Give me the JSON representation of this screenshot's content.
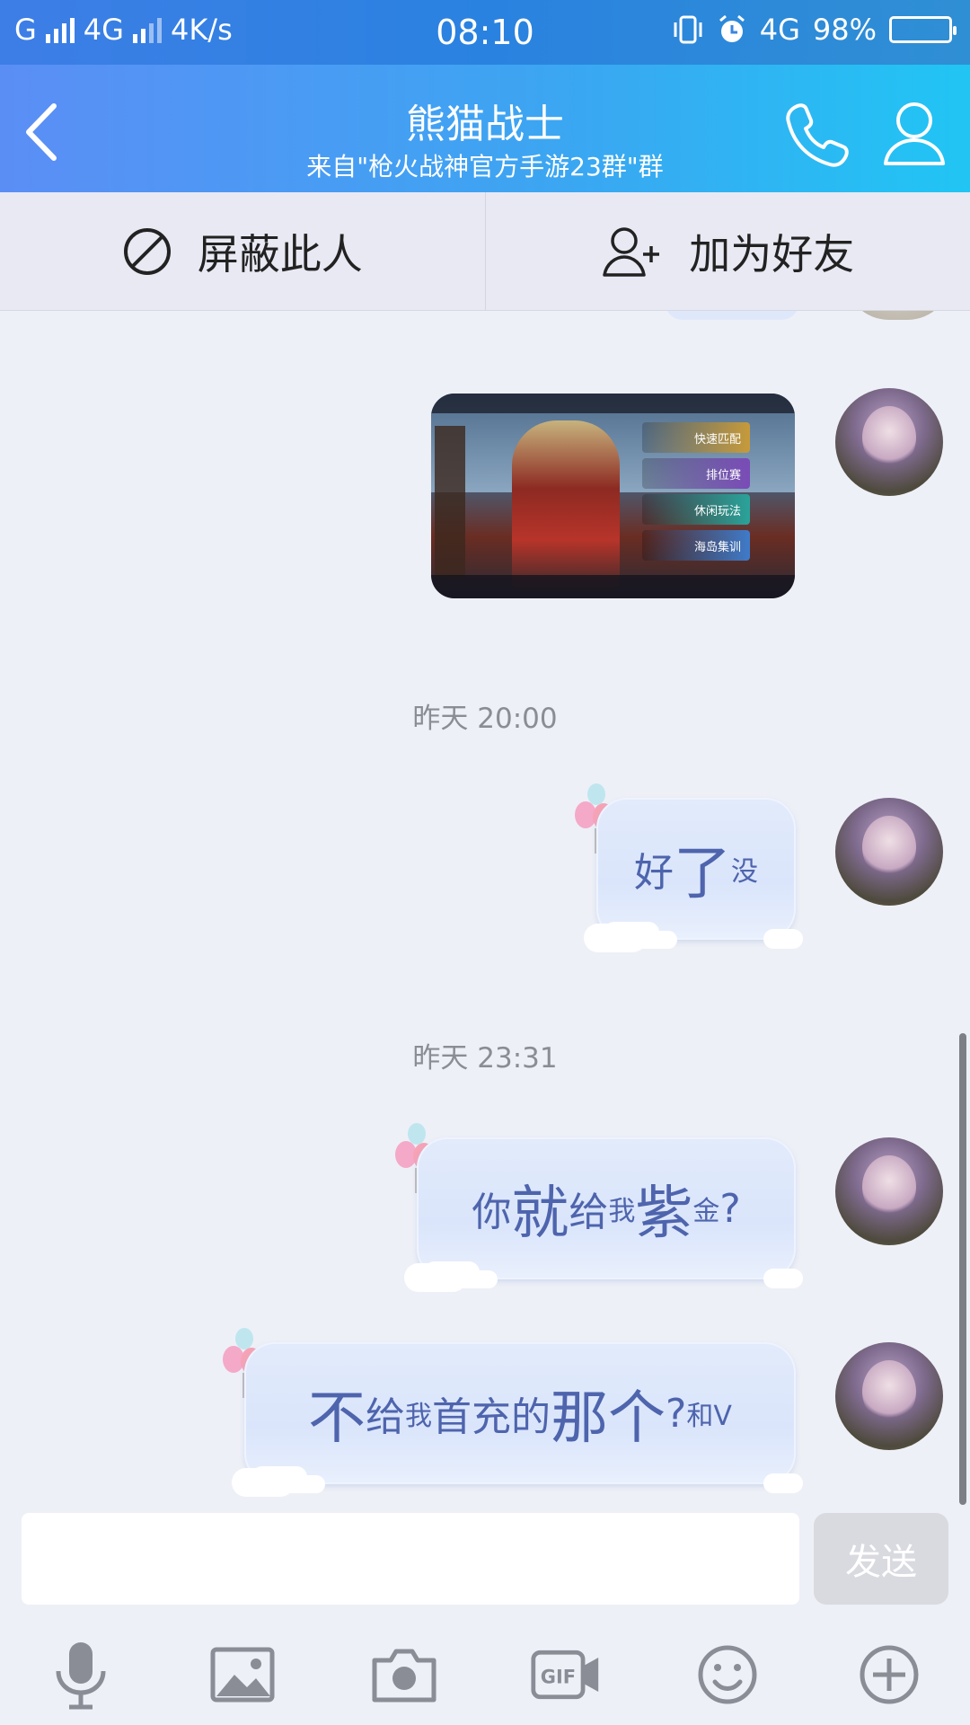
{
  "statusbar": {
    "carrier1": "G",
    "network1": "4G",
    "speed": "4K/s",
    "time": "08:10",
    "network2": "4G",
    "battery": "98%"
  },
  "header": {
    "title": "熊猫战士",
    "subtitle": "来自\"枪火战神官方手游23群\"群"
  },
  "actions": {
    "block_label": "屏蔽此人",
    "add_friend_label": "加为好友"
  },
  "messages": {
    "time1": "昨天 20:00",
    "msg1": [
      "好",
      "了",
      "没"
    ],
    "time2": "昨天 23:31",
    "msg2": [
      "你",
      "就",
      "给",
      "我",
      "紫",
      "金",
      "?"
    ],
    "msg3": [
      "不",
      "给",
      "我",
      "首充的",
      "那个",
      "?",
      "和V"
    ]
  },
  "image_message": {
    "menu": [
      "快速匹配",
      "排位赛",
      "休闲玩法",
      "海岛集训"
    ],
    "menu_colors": [
      "#c69a3a",
      "#7a4bb7",
      "#2aa39a",
      "#3f7bc9"
    ]
  },
  "input": {
    "placeholder": "",
    "send_label": "发送"
  },
  "toolbar": {
    "icons": [
      "microphone-icon",
      "image-icon",
      "camera-icon",
      "gif-icon",
      "emoji-icon",
      "plus-icon"
    ]
  },
  "colors": {
    "header_start": "#5b8ef5",
    "header_end": "#21c5f4",
    "bubble_text": "#4e64ad"
  }
}
